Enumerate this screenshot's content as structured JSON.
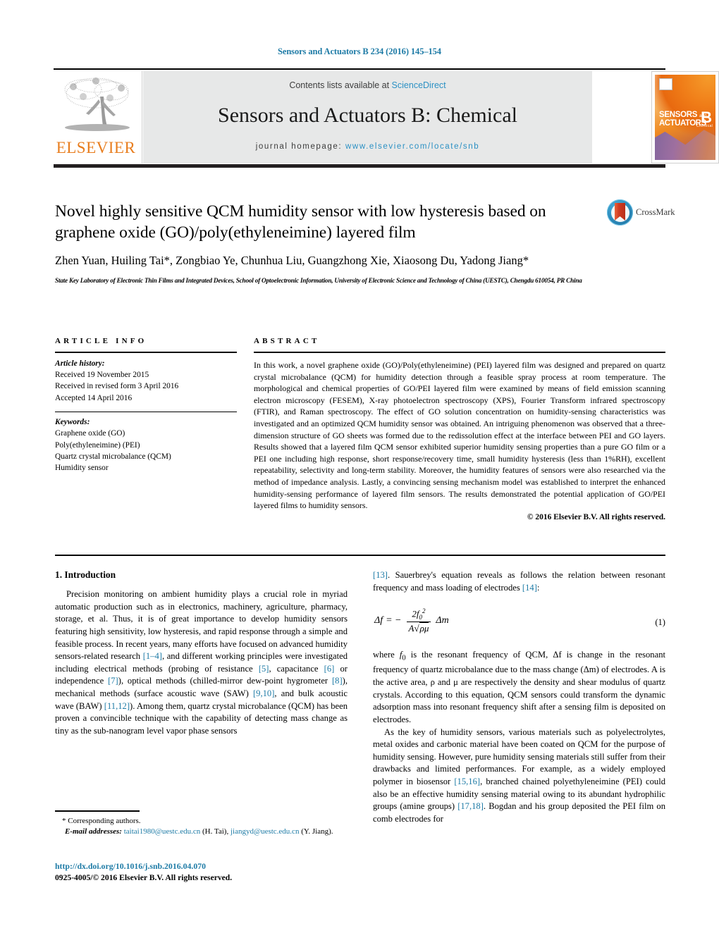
{
  "running_head": "Sensors and Actuators B 234 (2016) 145–154",
  "masthead": {
    "contents_prefix": "Contents lists available at ",
    "sciencedirect": "ScienceDirect",
    "journal_title": "Sensors and Actuators B: Chemical",
    "homepage_prefix": "journal homepage: ",
    "homepage_url": "www.elsevier.com/locate/snb",
    "publisher": "ELSEVIER",
    "cover": {
      "line1": "SENSORS",
      "line1_small": "and",
      "line2": "ACTUATORS",
      "letter": "B",
      "letter_sub": "Chemical"
    }
  },
  "crossmark": {
    "label": "CrossMark"
  },
  "article": {
    "title": "Novel highly sensitive QCM humidity sensor with low hysteresis based on graphene oxide (GO)/poly(ethyleneimine) layered film",
    "authors": "Zhen Yuan, Huiling Tai*, Zongbiao Ye, Chunhua Liu, Guangzhong Xie, Xiaosong Du, Yadong Jiang*",
    "affiliation": "State Key Laboratory of Electronic Thin Films and Integrated Devices, School of Optoelectronic Information, University of Electronic Science and Technology of China (UESTC), Chengdu 610054, PR China"
  },
  "article_info": {
    "heading": "ARTICLE INFO",
    "history_label": "Article history:",
    "history": [
      "Received 19 November 2015",
      "Received in revised form 3 April 2016",
      "Accepted 14 April 2016"
    ],
    "keywords_label": "Keywords:",
    "keywords": [
      "Graphene oxide (GO)",
      "Poly(ethyleneimine) (PEI)",
      "Quartz crystal microbalance (QCM)",
      "Humidity sensor"
    ]
  },
  "abstract": {
    "heading": "ABSTRACT",
    "text": "In this work, a novel graphene oxide (GO)/Poly(ethyleneimine) (PEI) layered film was designed and prepared on quartz crystal microbalance (QCM) for humidity detection through a feasible spray process at room temperature. The morphological and chemical properties of GO/PEI layered film were examined by means of field emission scanning electron microscopy (FESEM), X-ray photoelectron spectroscopy (XPS), Fourier Transform infrared spectroscopy (FTIR), and Raman spectroscopy. The effect of GO solution concentration on humidity-sensing characteristics was investigated and an optimized QCM humidity sensor was obtained. An intriguing phenomenon was observed that a three-dimension structure of GO sheets was formed due to the redissolution effect at the interface between PEI and GO layers. Results showed that a layered film QCM sensor exhibited superior humidity sensing properties than a pure GO film or a PEI one including high response, short response/recovery time, small humidity hysteresis (less than 1%RH), excellent repeatability, selectivity and long-term stability. Moreover, the humidity features of sensors were also researched via the method of impedance analysis. Lastly, a convincing sensing mechanism model was established to interpret the enhanced humidity-sensing performance of layered film sensors. The results demonstrated the potential application of GO/PEI layered films to humidity sensors.",
    "copyright": "© 2016 Elsevier B.V. All rights reserved."
  },
  "introduction": {
    "heading": "1. Introduction",
    "para1_a": "Precision monitoring on ambient humidity plays a crucial role in myriad automatic production such as in electronics, machinery, agriculture, pharmacy, storage, et al. Thus, it is of great importance to develop humidity sensors featuring high sensitivity, low hysteresis, and rapid response through a simple and feasible process. In recent years, many efforts have focused on advanced humidity sensors-related research ",
    "ref1": "[1–4]",
    "para1_b": ", and different working principles were investigated including electrical methods (probing of resistance ",
    "ref2": "[5]",
    "para1_c": ", capacitance ",
    "ref3": "[6]",
    "para1_d": " or independence ",
    "ref4": "[7]",
    "para1_e": "), optical methods (chilled-mirror dew-point hygrometer ",
    "ref5": "[8]",
    "para1_f": "), mechanical methods (surface acoustic wave (SAW) ",
    "ref6": "[9,10]",
    "para1_g": ", and bulk acoustic wave (BAW) ",
    "ref7": "[11,12]",
    "para1_h": "). Among them, quartz crystal microbalance (QCM) has been proven a convincible technique with the capability of detecting mass change as tiny as the sub-nanogram level vapor phase sensors ",
    "ref8": "[13]",
    "para1_i": ". Sauerbrey's equation reveals as follows the relation between resonant frequency and mass loading of electrodes ",
    "ref9": "[14]",
    "para1_j": ":",
    "equation": {
      "lhs": "Δf",
      "eq": "= −",
      "numerator": "2f",
      "numerator_sup": "2",
      "numerator_sub": "0",
      "denominator_a": "A",
      "denominator_b": "ρμ",
      "rhs": "Δm",
      "number": "(1)"
    },
    "para2_a": "where ",
    "para2_f0": "f",
    "para2_f0sub": "0",
    "para2_b": " is the resonant frequency of QCM, Δf is change in the resonant frequency of quartz microbalance due to the mass change (Δm) of electrodes. A is the active area, ρ and μ are respectively the density and shear modulus of quartz crystals. According to this equation, QCM sensors could transform the dynamic adsorption mass into resonant frequency shift after a sensing film is deposited on electrodes.",
    "para3_a": "As the key of humidity sensors, various materials such as polyelectrolytes, metal oxides and carbonic material have been coated on QCM for the purpose of humidity sensing. However, pure humidity sensing materials still suffer from their drawbacks and limited performances. For example, as a widely employed polymer in biosensor ",
    "ref10": "[15,16]",
    "para3_b": ", branched chained polyethyleneimine (PEI) could also be an effective humidity sensing material owing to its abundant hydrophilic groups (amine groups) ",
    "ref11": "[17,18]",
    "para3_c": ". Bogdan and his group deposited the PEI film on comb electrodes for"
  },
  "footnote": {
    "corresponding": "* Corresponding authors.",
    "email_label": "E-mail addresses:",
    "email1": "taitai1980@uestc.edu.cn",
    "email1_name": " (H. Tai), ",
    "email2": "jiangyd@uestc.edu.cn",
    "email2_name": " (Y. Jiang).",
    "doi": "http://dx.doi.org/10.1016/j.snb.2016.04.070",
    "issn": "0925-4005/© 2016 Elsevier B.V. All rights reserved."
  },
  "colors": {
    "link": "#1e7ba6",
    "sciencedirect": "#2c91c4",
    "elsevier_orange": "#e87d1e",
    "banner_gray": "#e7e8e8"
  }
}
